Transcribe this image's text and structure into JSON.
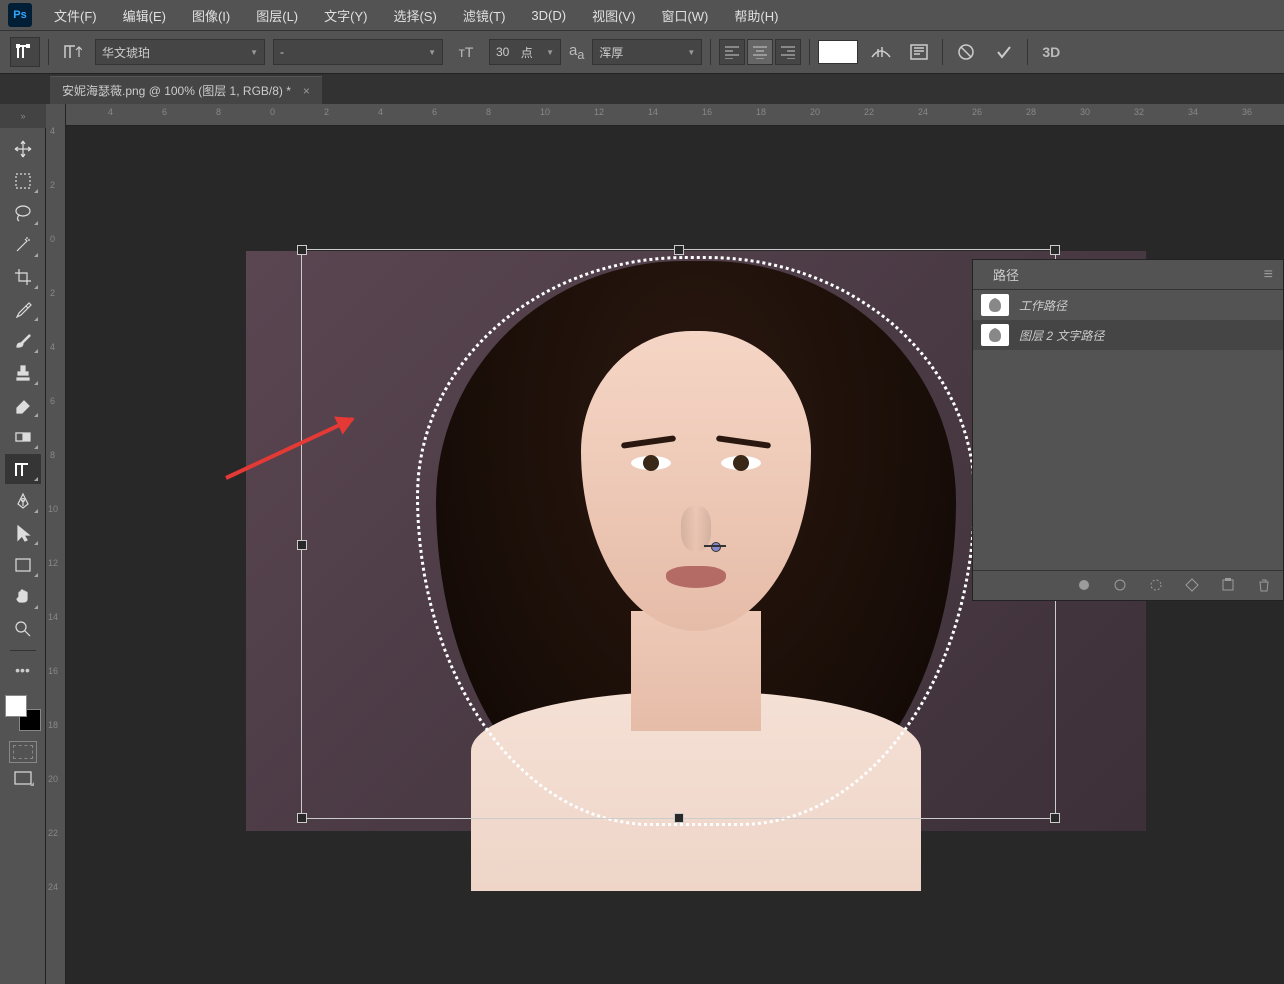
{
  "menubar": {
    "items": [
      "文件(F)",
      "编辑(E)",
      "图像(I)",
      "图层(L)",
      "文字(Y)",
      "选择(S)",
      "滤镜(T)",
      "3D(D)",
      "视图(V)",
      "窗口(W)",
      "帮助(H)"
    ]
  },
  "options": {
    "font_family": "华文琥珀",
    "font_style": "-",
    "font_size": "30",
    "font_unit": "点",
    "aa_mode": "浑厚",
    "threed": "3D"
  },
  "tab": {
    "title": "安妮海瑟薇.png @ 100% (图层 1, RGB/8) *"
  },
  "ruler": {
    "top": [
      "4",
      "6",
      "8",
      "0",
      "2",
      "4",
      "6",
      "8",
      "10",
      "12",
      "14",
      "16",
      "18",
      "20",
      "22",
      "24",
      "26",
      "28",
      "30",
      "32",
      "34",
      "36"
    ],
    "left": [
      "4",
      "2",
      "0",
      "2",
      "4",
      "6",
      "8",
      "10",
      "12",
      "14",
      "16",
      "18",
      "20",
      "22",
      "24"
    ]
  },
  "paths_panel": {
    "tab": "路径",
    "items": [
      {
        "name": "工作路径"
      },
      {
        "name": "图层 2 文字路径"
      }
    ]
  }
}
